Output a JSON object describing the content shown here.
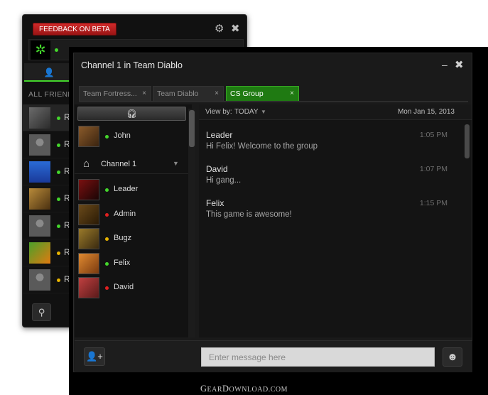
{
  "back_window": {
    "feedback_label": "FEEDBACK ON BETA",
    "gear_icon": "⚙",
    "close_icon": "✖",
    "user_icon": "👤",
    "all_friends_label": "ALL FRIENDS",
    "search_icon": "🔍",
    "friends": [
      {
        "name": "Ra",
        "status": "#44d62c",
        "avatar": "photo"
      },
      {
        "name": "Ra",
        "status": "#44d62c",
        "avatar": "default"
      },
      {
        "name": "Ra",
        "status": "#44d62c",
        "avatar": "logo"
      },
      {
        "name": "Ra",
        "status": "#44d62c",
        "avatar": "photo2"
      },
      {
        "name": "Ra",
        "status": "#44d62c",
        "avatar": "default"
      },
      {
        "name": "Ra",
        "status": "#e8b400",
        "avatar": "art"
      },
      {
        "name": "Ra",
        "status": "#e8b400",
        "avatar": "default"
      }
    ]
  },
  "window": {
    "title": "Channel 1 in Team Diablo",
    "minimize_icon": "–",
    "close_icon": "✖",
    "tabs": [
      {
        "label": "Team Fortress...",
        "active": false
      },
      {
        "label": "Team Diablo",
        "active": false
      },
      {
        "label": "CS Group",
        "active": true
      }
    ],
    "tab_close_icon": "×"
  },
  "left_panel": {
    "headset_icon": "🎧",
    "speaker": {
      "name": "John",
      "status": "#44d62c"
    },
    "channel_name": "Channel 1",
    "channel_caret": "▼",
    "home_icon": "⌂",
    "members": [
      {
        "name": "Leader",
        "status": "#44d62c"
      },
      {
        "name": "Admin",
        "status": "#e02020"
      },
      {
        "name": "Bugz",
        "status": "#e8b400"
      },
      {
        "name": "Felix",
        "status": "#44d62c"
      },
      {
        "name": "David",
        "status": "#e02020"
      }
    ]
  },
  "chat": {
    "view_by_label": "View by:",
    "view_by_value": "TODAY",
    "view_by_caret": "▼",
    "date": "Mon Jan 15, 2013",
    "messages": [
      {
        "author": "Leader",
        "text": "Hi Felix! Welcome to the group",
        "time": "1:05 PM"
      },
      {
        "author": "David",
        "text": "Hi gang...",
        "time": "1:07 PM"
      },
      {
        "author": "Felix",
        "text": "This game is awesome!",
        "time": "1:15 PM"
      }
    ]
  },
  "bottom": {
    "add_user_icon": "👤+",
    "input_placeholder": "Enter message here",
    "emoji_icon": "☻"
  },
  "watermark": {
    "first": "G",
    "rest1": "EAR",
    "second": "D",
    "rest2": "OWNLOAD.COM"
  },
  "colors": {
    "accent_green": "#44d62c",
    "feedback_red": "#c62020",
    "tab_active": "#1f7a12"
  }
}
